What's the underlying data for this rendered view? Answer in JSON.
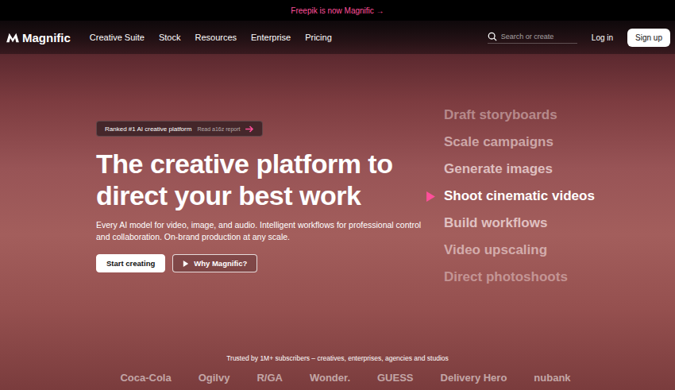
{
  "announcement": {
    "text": "Freepik is now Magnific →"
  },
  "nav": {
    "brand": "Magnific",
    "links": [
      "Creative Suite",
      "Stock",
      "Resources",
      "Enterprise",
      "Pricing"
    ],
    "search": {
      "placeholder": "Search or create"
    },
    "login": "Log in",
    "signup": "Sign up"
  },
  "hero": {
    "badge": {
      "label": "Ranked #1 AI creative platform",
      "link": "Read a16z report"
    },
    "title": "The creative platform to direct your best work",
    "description": "Every AI model for video, image, and audio. Intelligent workflows for professional control and collaboration. On-brand production at any scale.",
    "buttons": [
      {
        "label": "Start creating",
        "kind": "primary"
      },
      {
        "label": "Why Magnific?",
        "kind": "play"
      }
    ]
  },
  "features": [
    {
      "label": "Draft storyboards",
      "selected": false
    },
    {
      "label": "Scale campaigns",
      "selected": false
    },
    {
      "label": "Generate images",
      "selected": false
    },
    {
      "label": "Shoot cinematic videos",
      "selected": true
    },
    {
      "label": "Build workflows",
      "selected": false
    },
    {
      "label": "Video upscaling",
      "selected": false
    },
    {
      "label": "Direct photoshoots",
      "selected": false
    }
  ],
  "trusted": {
    "text": "Trusted by 1M+ subscribers – creatives, enterprises, agencies and studios",
    "logos": [
      "Coca-Cola",
      "Ogilvy",
      "R/GA",
      "Wonder.",
      "GUESS",
      "Delivery Hero",
      "nubank"
    ]
  }
}
